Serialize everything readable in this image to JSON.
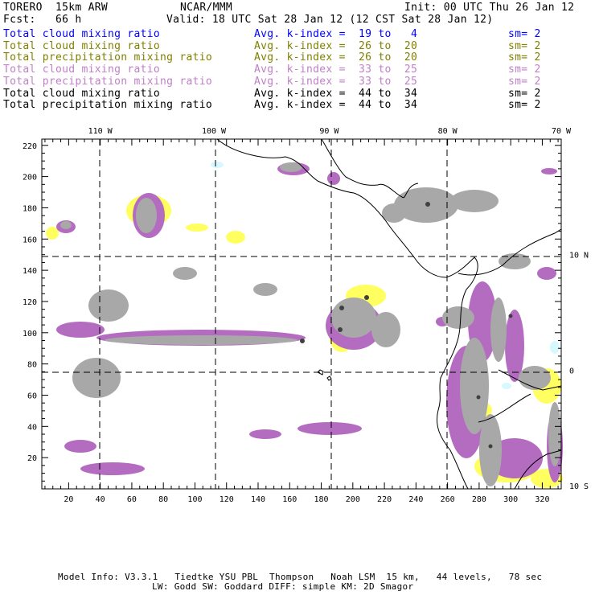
{
  "header": {
    "model": "TORERO  15km ARW",
    "org": "NCAR/MMM",
    "init": "Init: 00 UTC Thu 26 Jan 12",
    "fcst": "Fcst:   66 h",
    "valid": "Valid: 18 UTC Sat 28 Jan 12 (12 CST Sat 28 Jan 12)"
  },
  "legend": [
    {
      "field": "Total cloud mixing ratio",
      "kindex": "Avg. k-index =  19 to   4",
      "sm": "sm= 2",
      "color": "#0000ff"
    },
    {
      "field": "Total cloud mixing ratio",
      "kindex": "Avg. k-index =  26 to  20",
      "sm": "sm= 2",
      "color": "#808000"
    },
    {
      "field": "Total precipitation mixing ratio",
      "kindex": "Avg. k-index =  26 to  20",
      "sm": "sm= 2",
      "color": "#808000"
    },
    {
      "field": "Total cloud mixing ratio",
      "kindex": "Avg. k-index =  33 to  25",
      "sm": "sm= 2",
      "color": "#c080c8"
    },
    {
      "field": "Total precipitation mixing ratio",
      "kindex": "Avg. k-index =  33 to  25",
      "sm": "sm= 2",
      "color": "#c080c8"
    },
    {
      "field": "Total cloud mixing ratio",
      "kindex": "Avg. k-index =  44 to  34",
      "sm": "sm= 2",
      "color": "#000000"
    },
    {
      "field": "Total precipitation mixing ratio",
      "kindex": "Avg. k-index =  44 to  34",
      "sm": "sm= 2",
      "color": "#000000"
    }
  ],
  "footer": {
    "line1": "Model Info: V3.3.1   Tiedtke YSU PBL  Thompson   Noah LSM  15 km,   44 levels,   78 sec",
    "line2": "LW: Godd SW: Goddard DIFF: simple KM: 2D Smagor"
  },
  "chart_data": {
    "type": "heatmap",
    "title": "Total cloud / precipitation mixing ratio at k-index layers",
    "x_ticks": [
      20,
      40,
      60,
      80,
      100,
      120,
      140,
      160,
      180,
      200,
      220,
      240,
      260,
      280,
      300,
      320
    ],
    "y_ticks": [
      20,
      40,
      60,
      80,
      100,
      120,
      140,
      160,
      180,
      200,
      220
    ],
    "xlim": [
      3,
      332
    ],
    "ylim": [
      0,
      224
    ],
    "lon_labels": [
      {
        "label": "110 W",
        "x": 40
      },
      {
        "label": "100 W",
        "x": 112
      },
      {
        "label": "90 W",
        "x": 185
      },
      {
        "label": "80 W",
        "x": 260
      },
      {
        "label": "70 W",
        "x": 332
      }
    ],
    "lat_labels": [
      {
        "label": "10 N",
        "y": 150
      },
      {
        "label": "0",
        "y": 76
      },
      {
        "label": "10 S",
        "y": 2
      }
    ],
    "colors": {
      "low": "#d8f8ff",
      "mid": "#ffff60",
      "high": "#b46cc0",
      "top": "#a8a8a8",
      "core": "#404040"
    },
    "grid": true
  }
}
